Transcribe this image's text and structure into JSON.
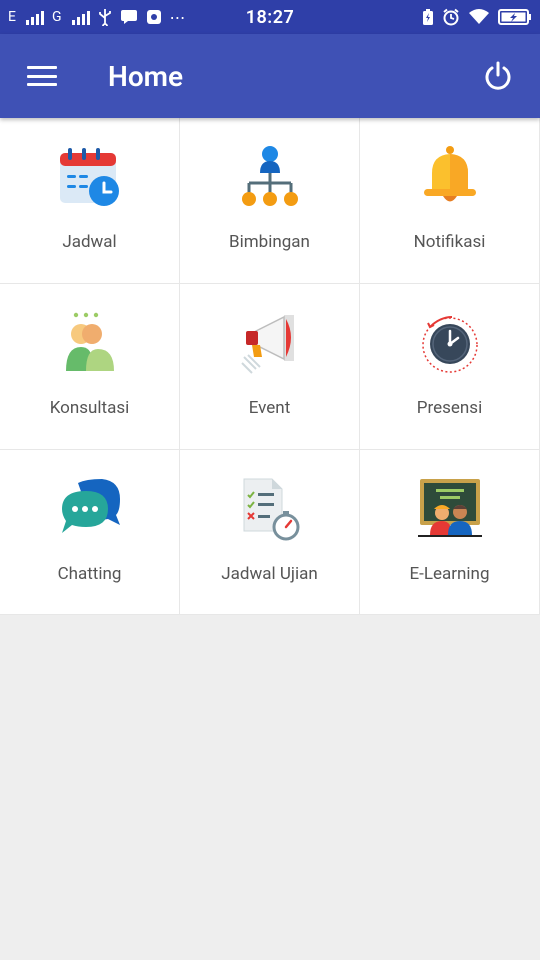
{
  "status_bar": {
    "net1": "E",
    "net2": "G",
    "time": "18:27",
    "dots": "⋯"
  },
  "app_bar": {
    "title": "Home",
    "color": "#3f51b5",
    "status_color": "#2f3fa8"
  },
  "menu": [
    {
      "label": "Jadwal",
      "icon": "calendar-clock-icon"
    },
    {
      "label": "Bimbingan",
      "icon": "org-chart-icon"
    },
    {
      "label": "Notifikasi",
      "icon": "bell-icon"
    },
    {
      "label": "Konsultasi",
      "icon": "consultation-people-icon"
    },
    {
      "label": "Event",
      "icon": "megaphone-icon"
    },
    {
      "label": "Presensi",
      "icon": "clock-icon"
    },
    {
      "label": "Chatting",
      "icon": "chat-bubbles-icon"
    },
    {
      "label": "Jadwal Ujian",
      "icon": "exam-checklist-timer-icon"
    },
    {
      "label": "E-Learning",
      "icon": "classroom-board-icon"
    }
  ]
}
